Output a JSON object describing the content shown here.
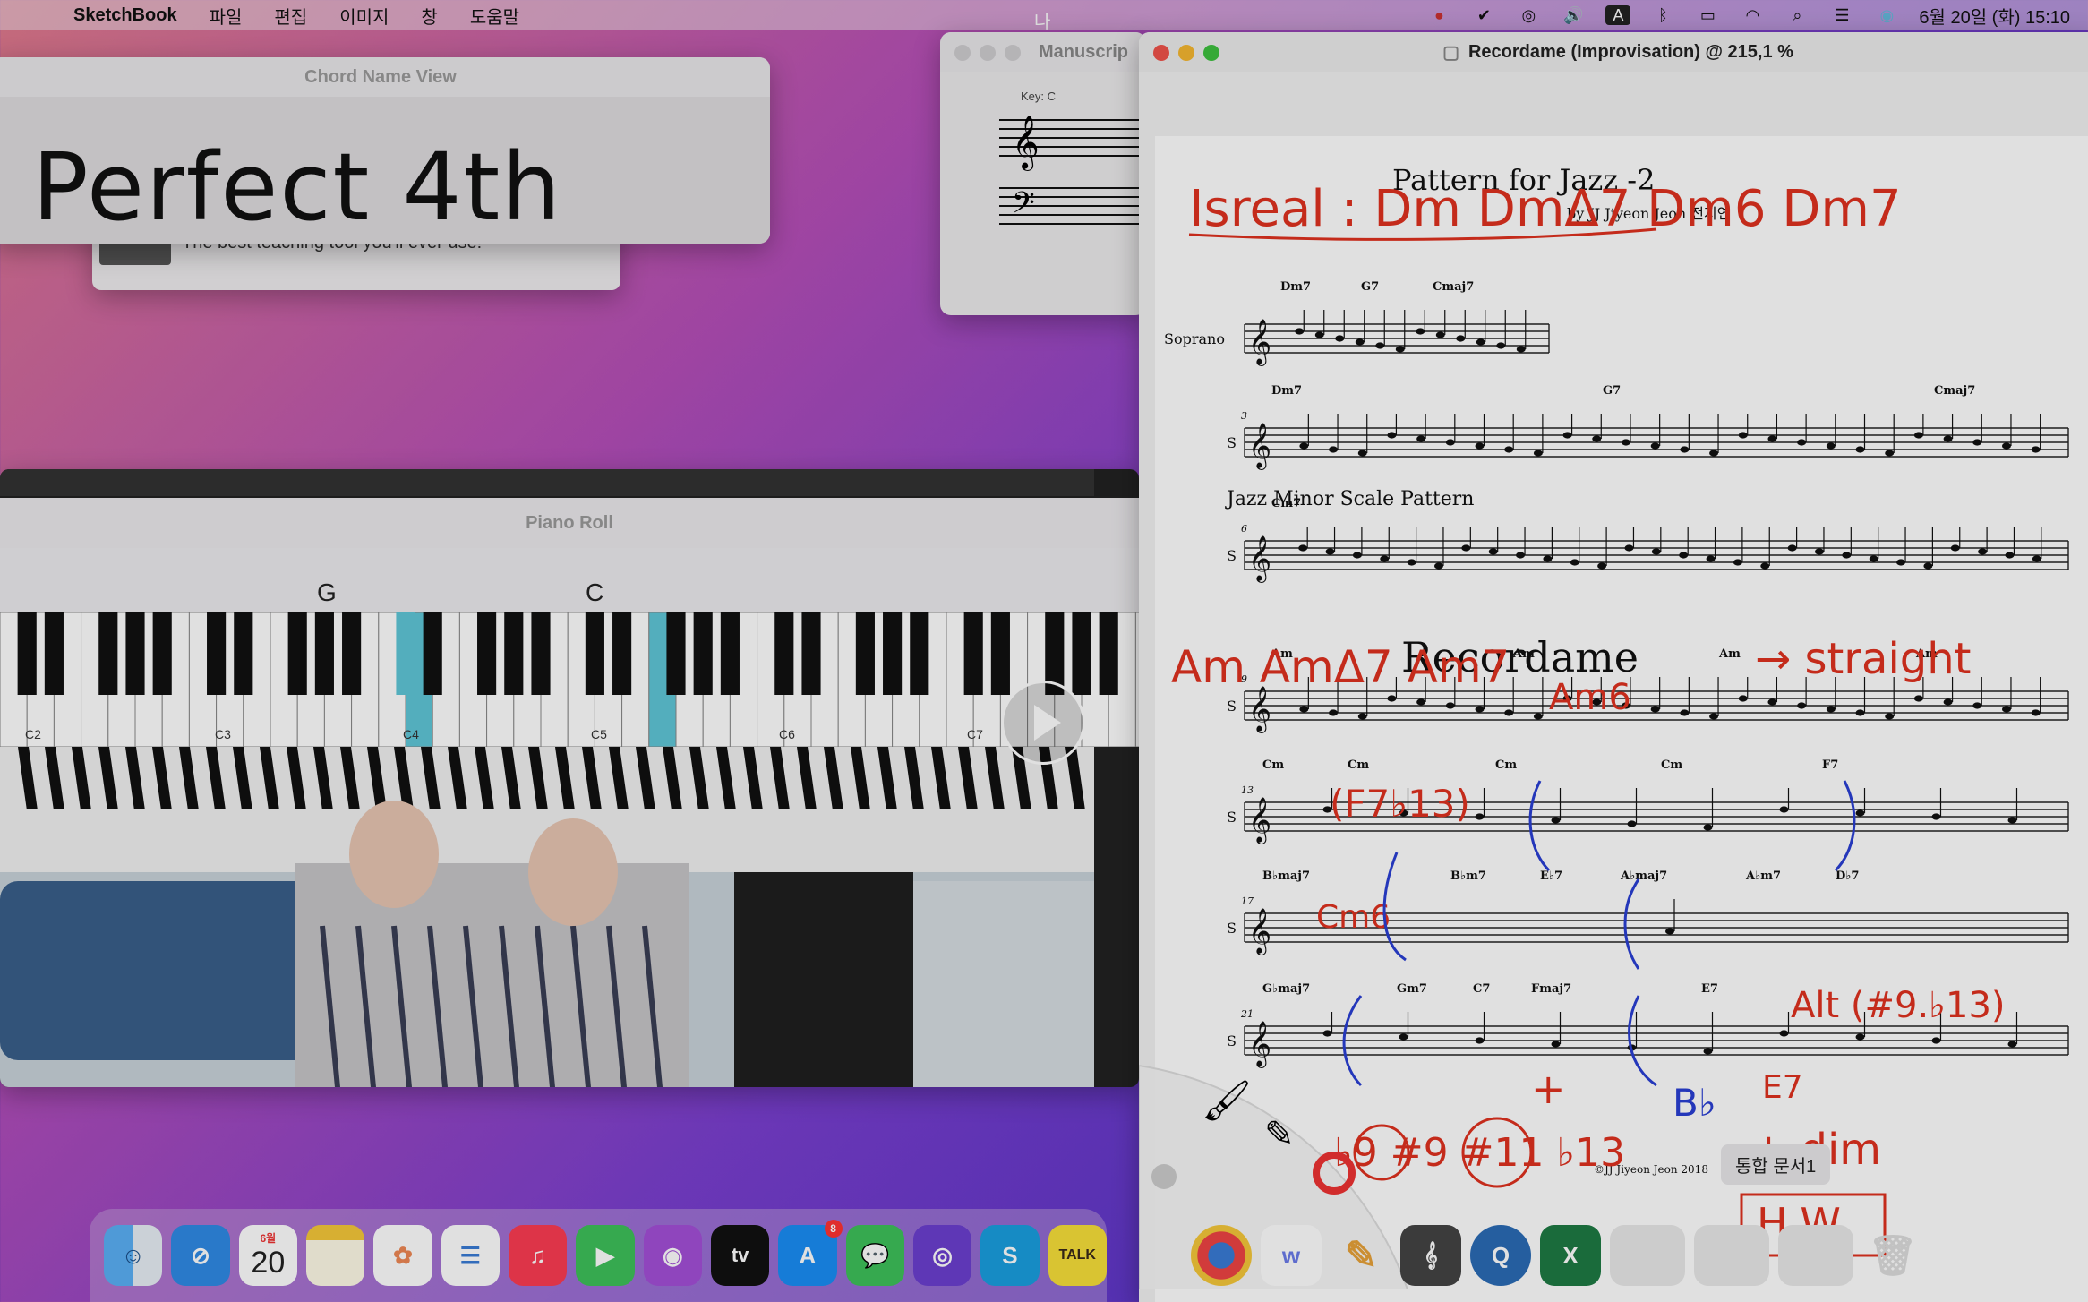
{
  "menubar": {
    "app_name": "SketchBook",
    "menus": [
      "파일",
      "편집",
      "이미지",
      "창",
      "도움말"
    ],
    "center_char": "나",
    "clock": "6월 20일 (화) 15:10"
  },
  "chord_window": {
    "title": "Chord Name View",
    "chord": "Perfect 4th"
  },
  "behind_window": {
    "text": "The best teaching tool you'll ever use!"
  },
  "manuscript_window": {
    "title": "Manuscrip",
    "key_label": "Key: C"
  },
  "score_window": {
    "title": "Recordame (Improvisation) @ 215,1 %",
    "score_title": "Pattern for Jazz -2",
    "composer": "by JJ Jiyeon Jeon 전지연",
    "part_label": "Soprano",
    "short_part": "S",
    "section_1": "Jazz Minor Scale Pattern",
    "section_2": "Recordame",
    "copyright": "©JJ Jiyeon Jeon 2018",
    "system_1_chords": [
      "Dm7",
      "G7",
      "Cmaj7"
    ],
    "system_2_chords": [
      "Dm7",
      "G7",
      "Cmaj7"
    ],
    "system_3_chords": [
      "Cm7"
    ],
    "system_4_chords": [
      "Am",
      "Am",
      "Am",
      "Am"
    ],
    "system_5_chords": [
      "Cm",
      "Cm",
      "Cm",
      "Cm",
      "F7"
    ],
    "system_6_chords": [
      "B♭maj7",
      "B♭m7",
      "E♭7",
      "A♭maj7",
      "A♭m7",
      "D♭7"
    ],
    "system_7_chords": [
      "G♭maj7",
      "Gm7",
      "C7",
      "Fmaj7",
      "E7"
    ],
    "bar_numbers": [
      "3",
      "6",
      "9",
      "13",
      "17",
      "21"
    ],
    "handwriting": {
      "top": "Isreal : Dm DmΔ7 Dm6 Dm7",
      "mid": "Am AmΔ7 Am7",
      "arrow": "→ straight",
      "am6": "Am6",
      "f713": "(F7♭13)",
      "cm6": "Cm6",
      "alt": "Alt (#9.♭13)",
      "b9": "♭9 #9 #11 ♭13",
      "plus": "+",
      "bb": "B♭",
      "e7": "E7",
      "dim": "+ dim",
      "hw": "H.W"
    }
  },
  "piano_roll": {
    "title": "Piano Roll",
    "chord_labels": [
      "G",
      "C"
    ],
    "octave_labels": [
      "C2",
      "C3",
      "C4",
      "C5",
      "C6",
      "C7"
    ]
  },
  "dock": {
    "calendar_month": "6월",
    "calendar_day": "20",
    "tv_label": "tv",
    "talk_label": "TALK",
    "badge_count": "8",
    "tooltip": "통합 문서1"
  },
  "colors": {
    "handwriting": "#e0311f",
    "handwriting_blue": "#2a3fd4",
    "highlight_key": "#5fc7d8"
  }
}
